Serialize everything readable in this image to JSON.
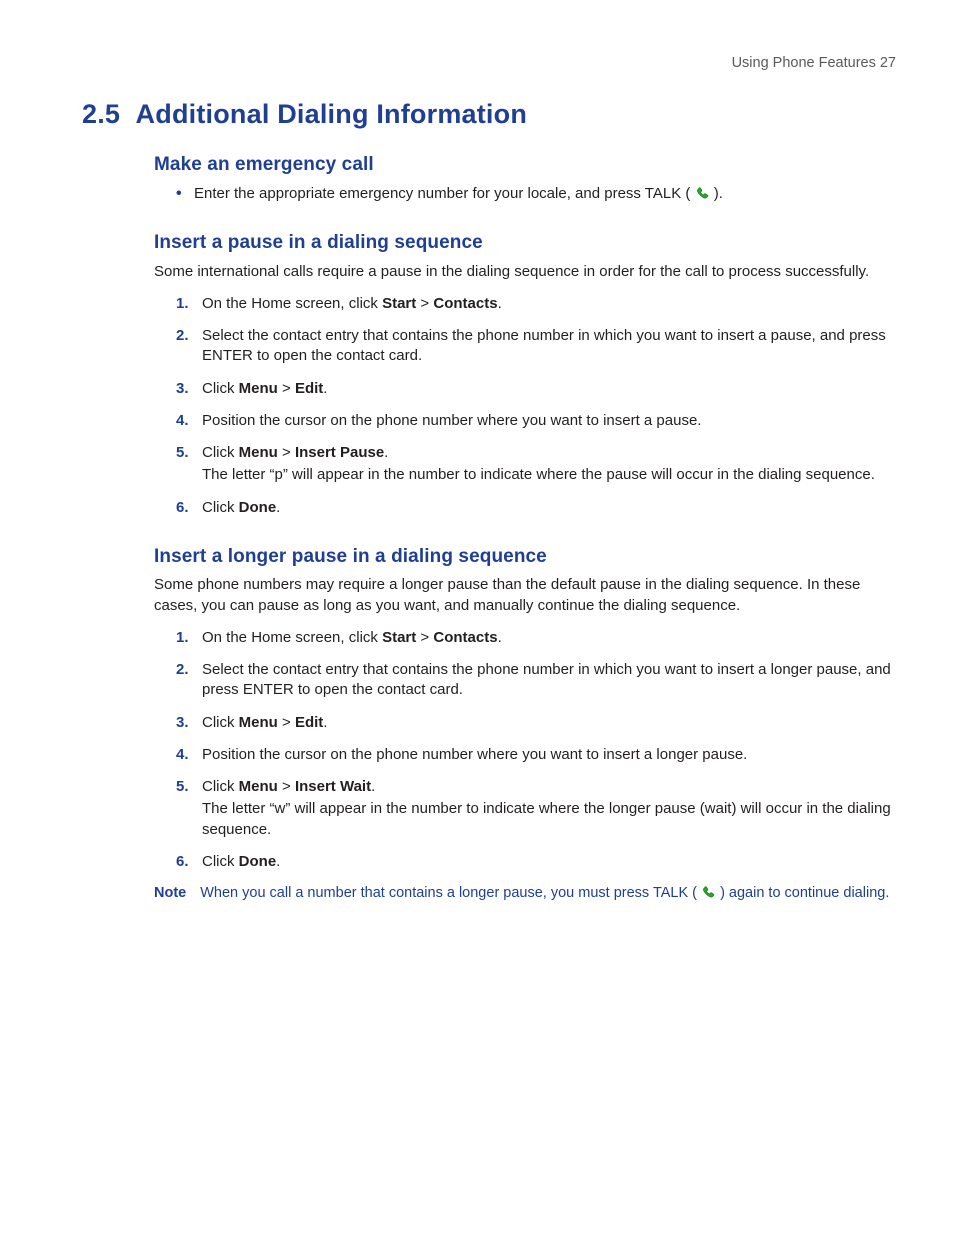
{
  "header": {
    "running": "Using Phone Features  27"
  },
  "title": {
    "num": "2.5",
    "text": "Additional Dialing Information"
  },
  "s1": {
    "heading": "Make an emergency call",
    "bullet_pre": "Enter the appropriate emergency number for your locale, and press TALK (",
    "bullet_post": ")."
  },
  "s2": {
    "heading": "Insert a pause in a dialing sequence",
    "intro": "Some international calls require a pause in the dialing sequence in order for the call to process successfully.",
    "steps": {
      "i1a": "On the Home screen, click ",
      "i1b": "Start",
      "i1c": " > ",
      "i1d": "Contacts",
      "i1e": ".",
      "i2": "Select the contact entry that contains the phone number in which you want to insert a pause, and press ENTER to open the contact card.",
      "i3a": "Click ",
      "i3b": "Menu",
      "i3c": " > ",
      "i3d": "Edit",
      "i3e": ".",
      "i4": "Position the cursor on the phone number where you want to insert a pause.",
      "i5a": "Click ",
      "i5b": "Menu",
      "i5c": " > ",
      "i5d": "Insert Pause",
      "i5e": ".",
      "i5f": "The letter “p” will appear in the number to indicate where the pause will occur in the dialing sequence.",
      "i6a": "Click ",
      "i6b": "Done",
      "i6c": "."
    }
  },
  "s3": {
    "heading": "Insert a longer pause in a dialing sequence",
    "intro": "Some phone numbers may require a longer pause than the default pause in the dialing sequence. In these cases, you can pause as long as you want, and manually continue the dialing sequence.",
    "steps": {
      "i1a": "On the Home screen, click ",
      "i1b": "Start",
      "i1c": " > ",
      "i1d": "Contacts",
      "i1e": ".",
      "i2": "Select the contact entry that contains the phone number in which you want to insert a longer pause, and press ENTER to open the contact card.",
      "i3a": "Click ",
      "i3b": "Menu",
      "i3c": " > ",
      "i3d": "Edit",
      "i3e": ".",
      "i4": "Position the cursor on the phone number where you want to insert a longer pause.",
      "i5a": "Click ",
      "i5b": "Menu",
      "i5c": " > ",
      "i5d": "Insert Wait",
      "i5e": ".",
      "i5f": "The letter “w” will appear in the number to indicate where the longer pause (wait) will occur in the dialing sequence.",
      "i6a": "Click ",
      "i6b": "Done",
      "i6c": "."
    },
    "note_label": "Note",
    "note_pre": "When you call a number that contains a longer pause, you must press TALK (",
    "note_post": ") again to continue dialing."
  }
}
